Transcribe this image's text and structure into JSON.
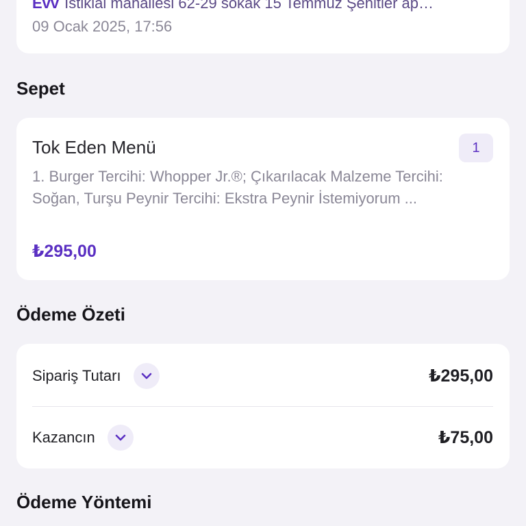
{
  "order": {
    "address_tag": "Evv",
    "address_text": "İstiklal mahallesi 62-29 sokak 15 Temmuz Şehitler ap…",
    "date": "09 Ocak 2025, 17:56"
  },
  "basket": {
    "title": "Sepet",
    "item": {
      "name": "Tok Eden Menü",
      "quantity": "1",
      "description": "1. Burger Tercihi: Whopper Jr.®; Çıkarılacak Malzeme Tercihi: Soğan, Turşu Peynir Tercihi: Ekstra Peynir İstemiyorum ...",
      "price": "₺295,00"
    }
  },
  "summary": {
    "title": "Ödeme Özeti",
    "rows": [
      {
        "label": "Sipariş Tutarı",
        "value": "₺295,00",
        "icon": "chevron-down-icon"
      },
      {
        "label": "Kazancın",
        "value": "₺75,00",
        "icon": "chevron-down-icon"
      }
    ]
  },
  "payment": {
    "title": "Ödeme Yöntemi"
  },
  "colors": {
    "accent": "#5a2fc2",
    "background": "#f3f2f7",
    "card": "#ffffff",
    "muted_text": "#8a8796"
  }
}
